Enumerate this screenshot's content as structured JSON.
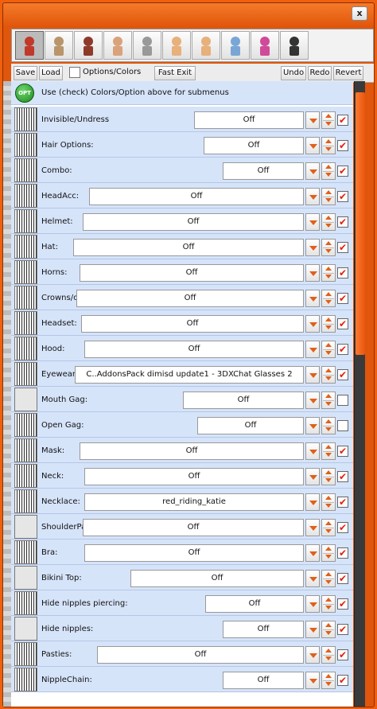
{
  "window": {
    "close_label": "x"
  },
  "icon_tabs": [
    {
      "name": "outfit-icon"
    },
    {
      "name": "hair-icon"
    },
    {
      "name": "makeup-icon"
    },
    {
      "name": "body-icon"
    },
    {
      "name": "tools-icon"
    },
    {
      "name": "face-icon"
    },
    {
      "name": "face-star-icon"
    },
    {
      "name": "card-icon"
    },
    {
      "name": "paint-icon"
    },
    {
      "name": "dress-icon"
    }
  ],
  "toolbar": {
    "save_label": "Save",
    "load_label": "Load",
    "options_label": "Options/Colors",
    "fast_exit_label": "Fast Exit",
    "undo_label": "Undo",
    "redo_label": "Redo",
    "revert_label": "Revert"
  },
  "options_hint": {
    "badge": "OPT",
    "text": "Use (check) Colors/Option above for submenus"
  },
  "rows": [
    {
      "label": "Invisible/Undress",
      "value": "Off",
      "checked": true
    },
    {
      "label": "Hair Options:",
      "value": "Off",
      "checked": true
    },
    {
      "label": "Combo:",
      "value": "Off",
      "checked": true
    },
    {
      "label": "HeadAcc:",
      "value": "Off",
      "checked": true
    },
    {
      "label": "Helmet:",
      "value": "Off",
      "checked": true
    },
    {
      "label": "Hat:",
      "value": "Off",
      "checked": true
    },
    {
      "label": "Horns:",
      "value": "Off",
      "checked": true
    },
    {
      "label": "Crowns/circlets:",
      "value": "Off",
      "checked": true
    },
    {
      "label": "Headset:",
      "value": "Off",
      "checked": true
    },
    {
      "label": "Hood:",
      "value": "Off",
      "checked": true
    },
    {
      "label": "Eyewear:",
      "value": "C..AddonsPack dimisd update1 - 3DXChat Glasses 2",
      "checked": true
    },
    {
      "label": "Mouth Gag:",
      "value": "Off",
      "checked": false
    },
    {
      "label": "Open Gag:",
      "value": "Off",
      "checked": false
    },
    {
      "label": "Mask:",
      "value": "Off",
      "checked": true
    },
    {
      "label": "Neck:",
      "value": "Off",
      "checked": true
    },
    {
      "label": "Necklace:",
      "value": "red_riding_katie",
      "checked": true
    },
    {
      "label": "ShoulderPads:",
      "value": "Off",
      "checked": true
    },
    {
      "label": "Bra:",
      "value": "Off",
      "checked": true
    },
    {
      "label": "Bikini Top:",
      "value": "Off",
      "checked": true
    },
    {
      "label": "Hide nipples piercing:",
      "value": "Off",
      "checked": true
    },
    {
      "label": "Hide nipples:",
      "value": "Off",
      "checked": true
    },
    {
      "label": "Pasties:",
      "value": "Off",
      "checked": true
    },
    {
      "label": "NippleChain:",
      "value": "Off",
      "checked": true
    }
  ],
  "colors": {
    "accent": "#e0560c",
    "row_bg": "#d6e4fa",
    "check": "#e02010"
  }
}
